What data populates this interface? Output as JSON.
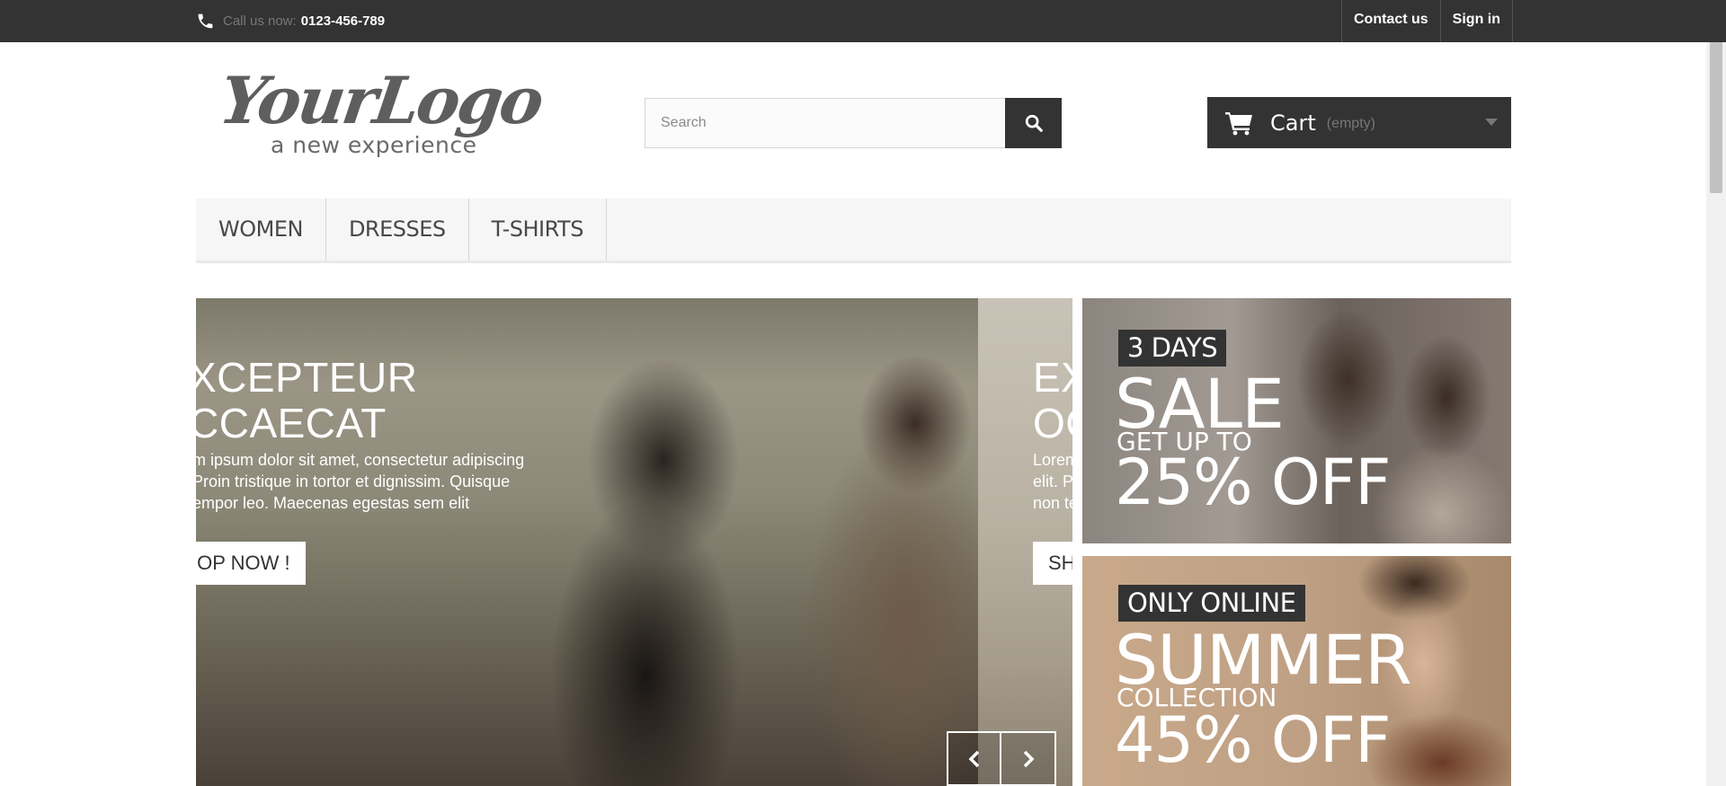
{
  "topbar": {
    "call_label": "Call us now:",
    "phone_number": "0123-456-789",
    "links": [
      "Contact us",
      "Sign in"
    ]
  },
  "logo": {
    "script_text": "YourLogo",
    "tagline": "a new experience"
  },
  "search": {
    "placeholder": "Search",
    "icon": "search-icon"
  },
  "cart": {
    "label": "Cart",
    "status": "(empty)",
    "icon": "cart-icon"
  },
  "nav": {
    "items": [
      "WOMEN",
      "DRESSES",
      "T-SHIRTS"
    ]
  },
  "slider": {
    "current": {
      "title_line1": "XCEPTEUR",
      "title_line2": "CCAECAT",
      "text_line1": "m ipsum dolor sit amet, consectetur adipiscing",
      "text_line2": "Proin tristique in tortor et dignissim. Quisque",
      "text_line3": "empor leo. Maecenas egestas sem elit",
      "button": "IOP NOW !"
    },
    "next": {
      "title_line1": "EX",
      "title_line2": "OC",
      "text_line1": "Lorem",
      "text_line2": "elit. P",
      "text_line3": "non te",
      "button": "SH"
    }
  },
  "banners": [
    {
      "tag": "3 DAYS",
      "headline": "SALE",
      "subline": "GET UP TO",
      "offer": "25% OFF"
    },
    {
      "tag": "ONLY ONLINE",
      "headline": "SUMMER",
      "subline": "COLLECTION",
      "offer": "45% OFF"
    }
  ],
  "colors": {
    "dark": "#333333",
    "nav_bg": "#f6f6f6",
    "muted": "#777777"
  }
}
